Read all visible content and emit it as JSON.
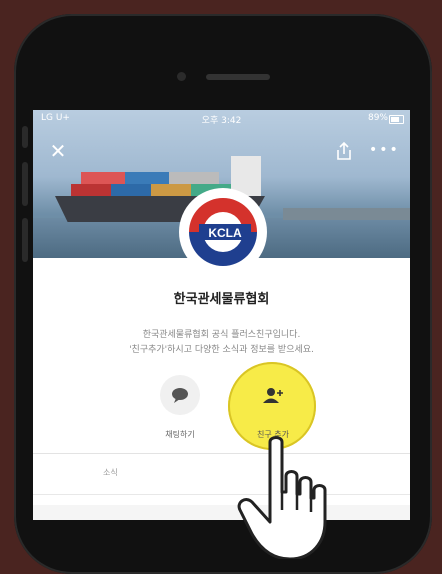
{
  "status_bar": {
    "carrier": "LG U+",
    "time": "오후 3:42",
    "battery": "89%"
  },
  "profile": {
    "logo_text": "KCLA",
    "name": "한국관세물류협회",
    "description_line1": "한국관세물류협회 공식 플러스친구입니다.",
    "description_line2": "'친구추가'하시고 다양한 소식과 정보를 받으세요."
  },
  "actions": {
    "chat_label": "채팅하기",
    "add_friend_label": "친구 추가"
  },
  "tabs": {
    "news_label": "소식"
  },
  "colors": {
    "highlight": "#f7ea3f",
    "logo_red": "#d4322c",
    "logo_blue": "#1f3f8f",
    "background": "#4a2420"
  },
  "icons": {
    "close": "close-icon",
    "share": "share-icon",
    "more": "more-icon",
    "chat": "chat-bubble-icon",
    "add_friend": "add-friend-icon",
    "pointer": "pointing-hand-icon"
  }
}
